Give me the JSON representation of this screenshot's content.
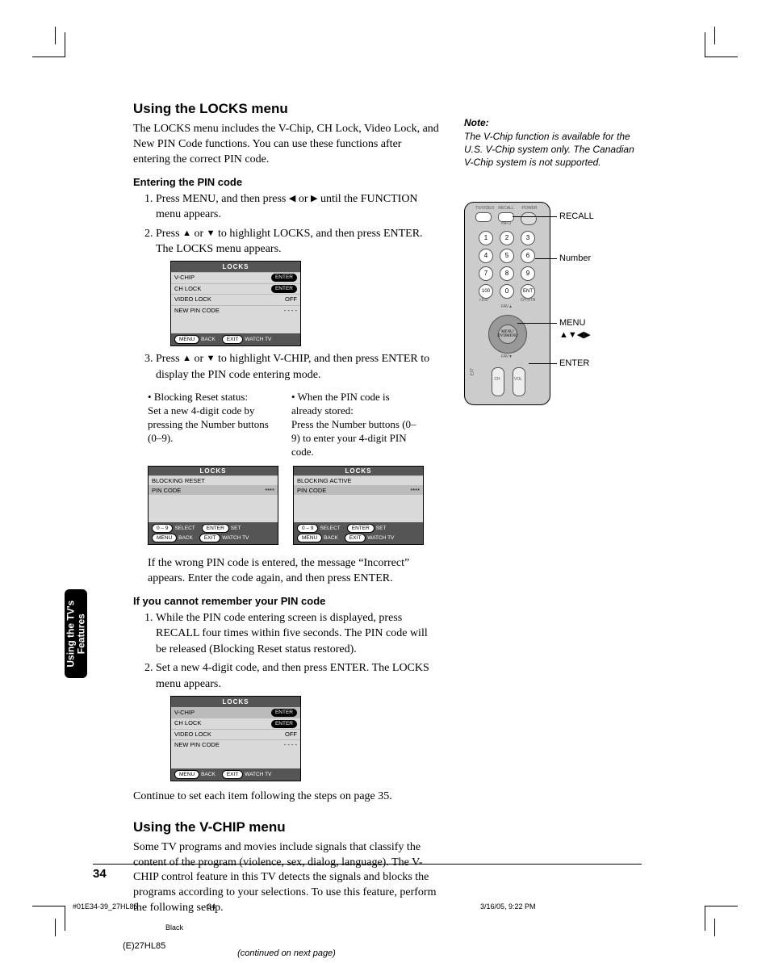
{
  "headings": {
    "locks": "Using the LOCKS menu",
    "entering": "Entering the PIN code",
    "forgot": "If you cannot remember your PIN code",
    "vchip": "Using the V-CHIP menu"
  },
  "paras": {
    "locks_intro": "The LOCKS menu includes the V-Chip, CH Lock, Video Lock, and New PIN Code functions. You can use these functions after entering the correct PIN code.",
    "step1a": "Press MENU, and then press ",
    "step1b": " or ",
    "step1c": " until the FUNCTION menu appears.",
    "step2a": "Press ",
    "step2b": " or ",
    "step2c": " to highlight LOCKS, and then press ENTER. The LOCKS menu appears.",
    "step3a": "Press ",
    "step3b": " or ",
    "step3c": " to highlight V-CHIP, and then press ENTER to display the PIN code entering mode.",
    "bul_l": "Blocking Reset status:\nSet a new 4-digit code by pressing the Number buttons (0–9).",
    "bul_r": "When the PIN code is already stored:\nPress the Number buttons (0–9) to enter your 4-digit PIN code.",
    "wrong": "If the wrong PIN code is entered, the message “Incorrect” appears. Enter the code again, and then press ENTER.",
    "forgot1": "While the PIN code entering screen is displayed, press RECALL four times within five seconds. The PIN code will be released (Blocking Reset status restored).",
    "forgot2": "Set a new 4-digit code, and then press ENTER. The LOCKS menu appears.",
    "cont_set": "Continue to set each item following the steps on page 35.",
    "vchip_body": "Some TV programs and movies include signals that classify the content of the program (violence, sex, dialog, language). The V-CHIP control feature in this TV detects the signals and blocks the programs according to your selections. To use this feature, perform the following setup.",
    "continued": "(continued on next page)"
  },
  "note": {
    "h": "Note:",
    "b": "The V-Chip function is available for the U.S. V-Chip system only. The Canadian V-Chip system is not supported."
  },
  "osd": {
    "title": "LOCKS",
    "vchip": "V-CHIP",
    "chlock": "CH LOCK",
    "video": "VIDEO LOCK",
    "newpin": "NEW PIN CODE",
    "enter": "ENTER",
    "off": "OFF",
    "dash": "- - - -",
    "menu": "MENU",
    "back": "BACK",
    "exit": "EXIT",
    "watch": "WATCH TV",
    "breset": "BLOCKING RESET",
    "bactive": "BLOCKING ACTIVE",
    "pincode": "PIN CODE",
    "select": "SELECT",
    "set": "SET",
    "keys09": "0 – 9",
    "stars": "****"
  },
  "remote": {
    "recall": "RECALL",
    "number": "Number",
    "menu": "MENU",
    "arrows": "▲▼◀▶",
    "enter": "ENTER",
    "tvvideo": "TV/VIDEO",
    "recall_s": "RECALL",
    "power": "POWER",
    "info": "INFO",
    "chrtn": "CH RTN",
    "plus100": "+100",
    "favup": "FAV▲",
    "favdn": "FAV▼",
    "menu_c": "MENU/\nDVDMENU",
    "ch": "CH",
    "vol": "VOL",
    "ext": "EXT"
  },
  "side_tab": "Using the TV's\nFeatures",
  "page_num": "34",
  "footer": {
    "file": "#01E34-39_27HL85",
    "pg": "34",
    "ts": "3/16/05, 9:22 PM",
    "black": "Black",
    "doc": "(E)27HL85"
  }
}
